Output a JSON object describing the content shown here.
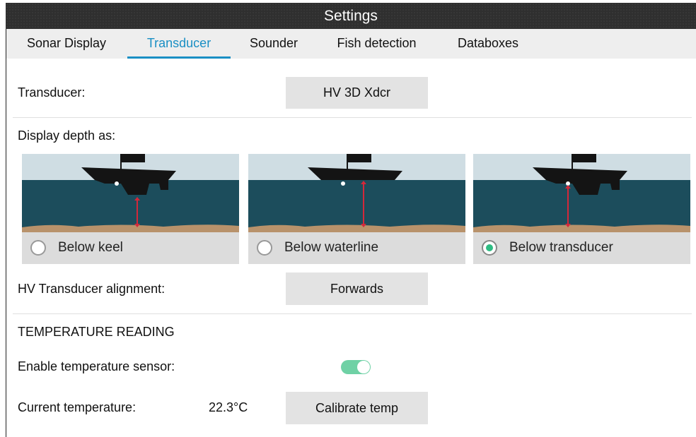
{
  "window": {
    "title": "Settings"
  },
  "tabs": [
    {
      "label": "Sonar Display",
      "active": false
    },
    {
      "label": "Transducer",
      "active": true
    },
    {
      "label": "Sounder",
      "active": false
    },
    {
      "label": "Fish detection",
      "active": false
    },
    {
      "label": "Databoxes",
      "active": false
    }
  ],
  "transducer": {
    "label": "Transducer:",
    "value": "HV 3D Xdcr"
  },
  "display_depth": {
    "label": "Display depth as:",
    "options": [
      {
        "label": "Below keel",
        "selected": false,
        "image": "depth-below-keel-diagram"
      },
      {
        "label": "Below waterline",
        "selected": false,
        "image": "depth-below-waterline-diagram"
      },
      {
        "label": "Below transducer",
        "selected": true,
        "image": "depth-below-transducer-diagram"
      }
    ]
  },
  "alignment": {
    "label": "HV Transducer alignment:",
    "value": "Forwards"
  },
  "temperature": {
    "section_title": "TEMPERATURE READING",
    "enable_label": "Enable temperature sensor:",
    "enabled": true,
    "current_label": "Current temperature:",
    "current_value": "22.3°C",
    "calibrate_label": "Calibrate temp"
  },
  "colors": {
    "accent": "#1a8fc4",
    "toggle_on": "#6fd1a5",
    "radio_selected": "#2ebc83",
    "sky": "#cfdde3",
    "water": "#1c4d5c",
    "seabed": "#b8926b",
    "depth_arrow": "#d4283a"
  }
}
